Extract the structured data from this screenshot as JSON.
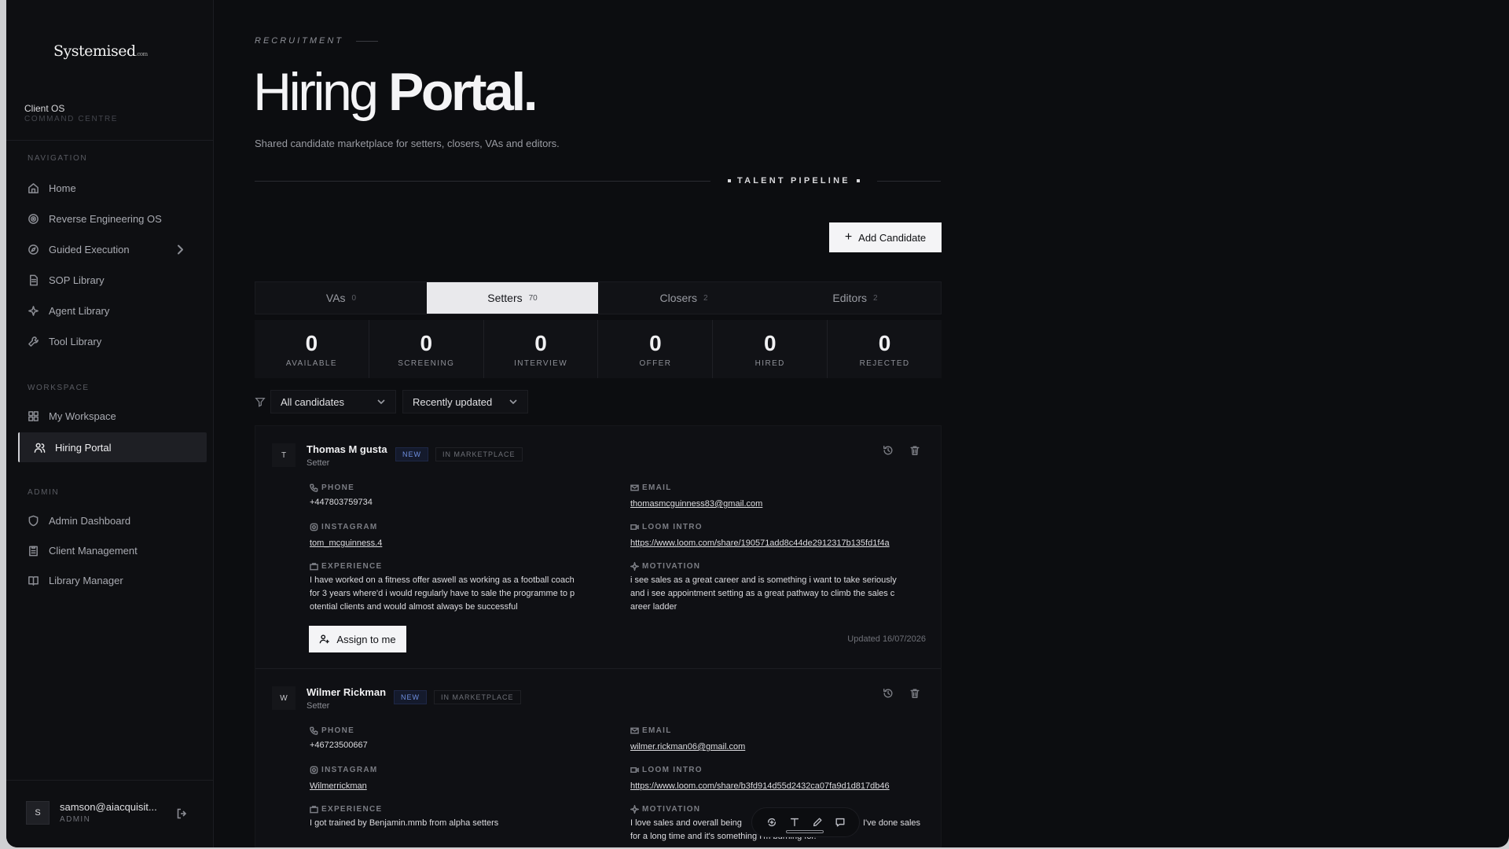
{
  "brand": {
    "name": "Systemised",
    "suffix": ".com"
  },
  "client": {
    "title": "Client OS",
    "subtitle": "COMMAND CENTRE"
  },
  "sidebar": {
    "nav_title": "NAVIGATION",
    "nav": [
      {
        "label": "Home",
        "icon": "home-icon"
      },
      {
        "label": "Reverse Engineering OS",
        "icon": "target-icon"
      },
      {
        "label": "Guided Execution",
        "icon": "compass-icon"
      },
      {
        "label": "SOP Library",
        "icon": "document-icon"
      },
      {
        "label": "Agent Library",
        "icon": "sparkle-icon"
      },
      {
        "label": "Tool Library",
        "icon": "wrench-icon"
      }
    ],
    "workspace_title": "WORKSPACE",
    "workspace": [
      {
        "label": "My Workspace",
        "icon": "grid-icon"
      },
      {
        "label": "Hiring Portal",
        "icon": "users-icon"
      }
    ],
    "admin_title": "ADMIN",
    "admin": [
      {
        "label": "Admin Dashboard",
        "icon": "shield-icon"
      },
      {
        "label": "Client Management",
        "icon": "clipboard-icon"
      },
      {
        "label": "Library Manager",
        "icon": "book-icon"
      }
    ]
  },
  "user": {
    "initial": "S",
    "email": "samson@aiacquisit...",
    "role": "ADMIN"
  },
  "header": {
    "eyebrow": "RECRUITMENT",
    "title_light": "Hiring",
    "title_bold": "Portal.",
    "subtitle": "Shared candidate marketplace for setters, closers, VAs and editors.",
    "section": "TALENT PIPELINE"
  },
  "add_button": "Add Candidate",
  "tabs": [
    {
      "label": "VAs",
      "count": "0"
    },
    {
      "label": "Setters",
      "count": "70"
    },
    {
      "label": "Closers",
      "count": "2"
    },
    {
      "label": "Editors",
      "count": "2"
    }
  ],
  "stats": [
    {
      "value": "0",
      "label": "AVAILABLE"
    },
    {
      "value": "0",
      "label": "SCREENING"
    },
    {
      "value": "0",
      "label": "INTERVIEW"
    },
    {
      "value": "0",
      "label": "OFFER"
    },
    {
      "value": "0",
      "label": "HIRED"
    },
    {
      "value": "0",
      "label": "REJECTED"
    }
  ],
  "filters": {
    "candidates": "All candidates",
    "sort": "Recently updated"
  },
  "field_labels": {
    "phone": "PHONE",
    "email": "EMAIL",
    "instagram": "INSTAGRAM",
    "loom": "LOOM INTRO",
    "experience": "EXPERIENCE",
    "motivation": "MOTIVATION"
  },
  "badges": {
    "new": "NEW",
    "marketplace": "IN MARKETPLACE"
  },
  "assign_label": "Assign to me",
  "candidates": [
    {
      "initial": "T",
      "name": "Thomas M gusta",
      "role": "Setter",
      "phone": "+447803759734",
      "email": "thomasmcguinness83@gmail.com",
      "instagram": "tom_mcguinness.4",
      "loom": "https://www.loom.com/share/190571add8c44de2912317b135fd1f4a",
      "experience_lines": [
        "I have worked on a fitness offer aswell as working as a football coach",
        "for 3 years where'd i would regularly have to sale the programme to p",
        "otential clients and would almost always be successful"
      ],
      "motivation_lines": [
        "i see sales as a great career and is something i want to take seriously",
        "and i see appointment setting as a great pathway to climb the sales c",
        "areer ladder"
      ],
      "updated": "Updated 16/07/2026"
    },
    {
      "initial": "W",
      "name": "Wilmer Rickman",
      "role": "Setter",
      "phone": "+46723500667",
      "email": "wilmer.rickman06@gmail.com",
      "instagram": "Wilmerrickman",
      "loom": "https://www.loom.com/share/b3fd914d55d2432ca07fa9d1d817db46",
      "experience_lines": [
        "I got trained by Benjamin.mmb from alpha setters"
      ],
      "motivation_lines": [
        "I love sales and overall being",
        "I've done sales",
        "for a long time and it's something I'm burning for."
      ]
    }
  ]
}
